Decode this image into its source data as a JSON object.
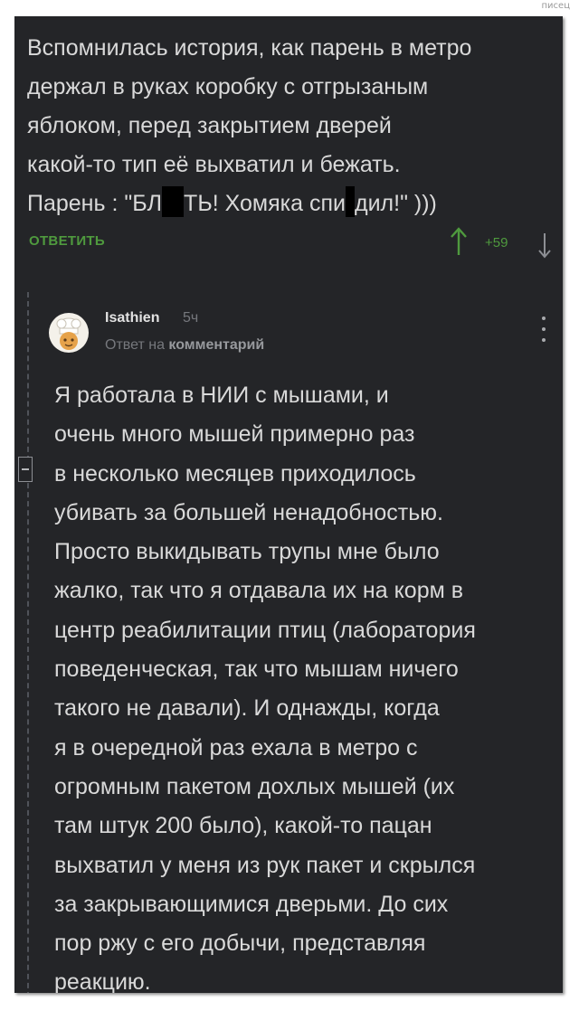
{
  "watermark": "писец",
  "parent_comment": {
    "text_line1": "Вспомнилась история, как парень в метро",
    "text_line2": "держал в руках коробку с отгрызаным",
    "text_line3": "яблоком, перед закрытием дверей",
    "text_line4": "какой-то тип её выхватил и бежать.",
    "text_line5_a": "Парень : \"БЛ",
    "text_line5_b": "ТЬ! Хомяка спи",
    "text_line5_c": "дил!\" )))",
    "reply_label": "ОТВЕТИТЬ",
    "score": "+59",
    "icons": {
      "upvote": "arrow-up-icon",
      "downvote": "arrow-down-icon",
      "censor": "censor-bar"
    }
  },
  "reply_comment": {
    "username": "Isathien",
    "time": "5ч",
    "reply_prefix": "Ответ на",
    "reply_target": "комментарий",
    "lines": [
      "Я работала в НИИ с мышами, и",
      "очень много мышей примерно раз",
      "в несколько месяцев приходилось",
      "убивать за большей ненадобностью.",
      "Просто выкидывать трупы мне было",
      "жалко, так что я отдавала их на корм в",
      "центр реабилитации птиц (лаборатория",
      "поведенческая, так что мышам ничего",
      "такого не давали). И однажды, когда",
      "я в очередной раз ехала в метро с",
      "огромным пакетом дохлых мышей (их",
      "там штук 200 было), какой-то пацан",
      "выхватил у меня из рук пакет и скрылся",
      "за закрывающимися дверьми. До сих",
      "пор ржу с его добычи, представляя",
      "реакцию."
    ],
    "icons": {
      "avatar": "chef-avatar-icon",
      "menu": "more-vertical-icon",
      "collapse": "collapse-minus-icon"
    }
  },
  "colors": {
    "background": "#242528",
    "text": "#d9d9d9",
    "accent_green": "#4f9a3e",
    "muted": "#76787d"
  }
}
